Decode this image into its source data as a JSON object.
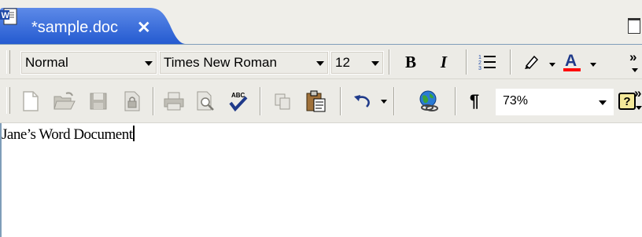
{
  "tab": {
    "title": "*sample.doc",
    "close_label": "✕",
    "icon": "word-doc-icon"
  },
  "formatting_toolbar": {
    "style": "Normal",
    "font": "Times New Roman",
    "size": "12",
    "bold_label": "B",
    "italic_label": "I",
    "more_label": "»"
  },
  "standard_toolbar": {
    "zoom": "73%",
    "pilcrow_label": "¶",
    "help_label": "?",
    "more_label": "»"
  },
  "document": {
    "text": "Jane’s Word Document"
  },
  "colors": {
    "tab_blue": "#2d63d6",
    "font_color_red": "#ff0000",
    "toolbar_bg": "#ecebe6"
  }
}
